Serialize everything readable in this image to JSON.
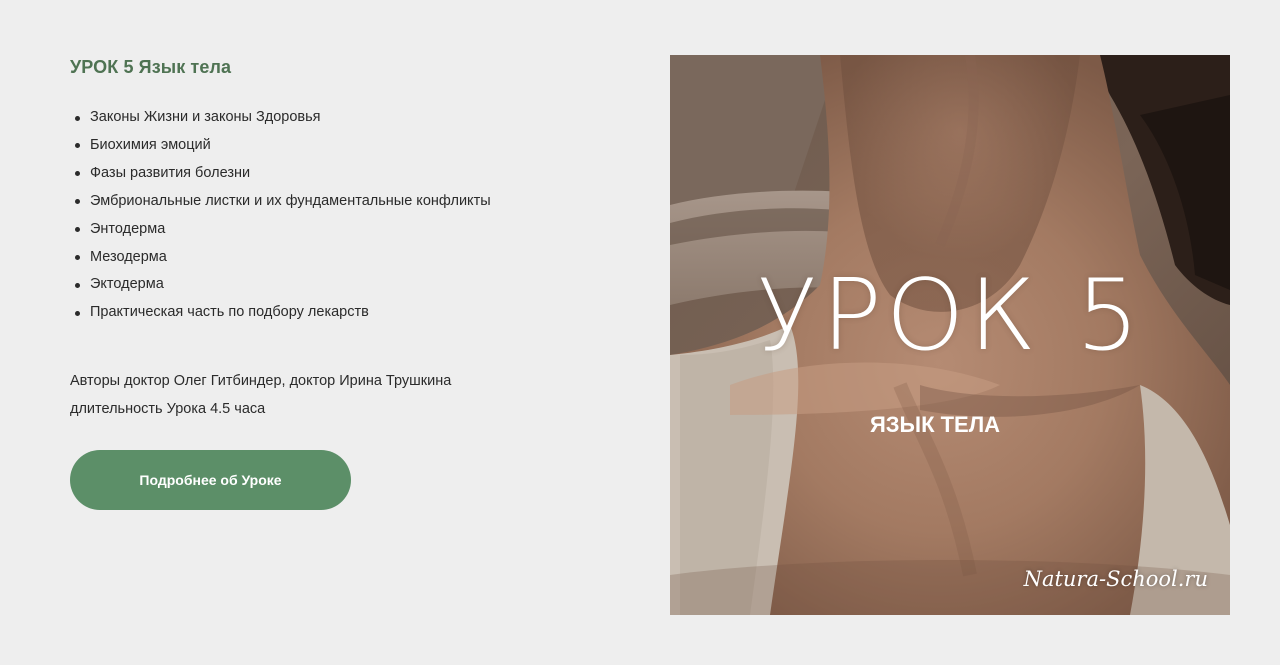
{
  "lesson": {
    "title": "УРОК 5 Язык тела",
    "topics": [
      "Законы Жизни и законы Здоровья",
      "Биохимия эмоций",
      "Фазы развития болезни",
      "Эмбриональные листки и их фундаментальные конфликты",
      "Энтодерма",
      "Мезодерма",
      "Эктодерма",
      "Практическая часть по подбору лекарств"
    ],
    "authors": "Авторы доктор Олег Гитбиндер, доктор Ирина Трушкина",
    "duration": "длительность Урока 4.5 часа",
    "button_label": "Подробнее об Уроке"
  },
  "cover": {
    "heading": "УРОК 5",
    "subtitle": "ЯЗЫК ТЕЛА",
    "watermark": "Natura-School.ru"
  },
  "colors": {
    "background": "#eeeeee",
    "title": "#4f7353",
    "button": "#5c8f68",
    "text": "#2b2b2b"
  }
}
